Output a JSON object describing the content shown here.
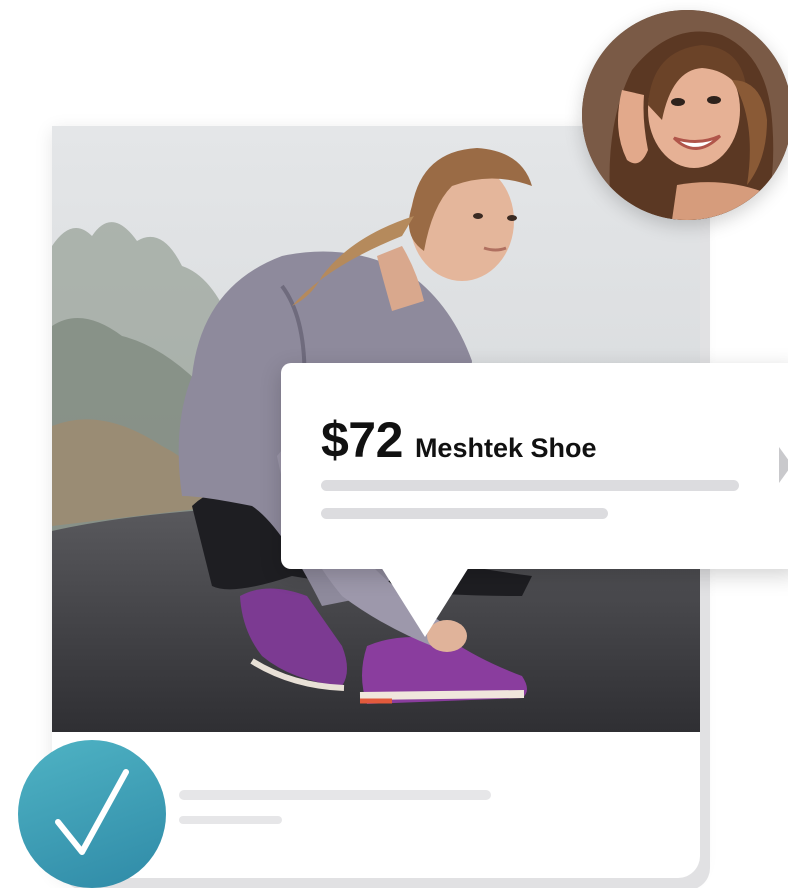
{
  "product": {
    "price": "$72",
    "name": "Meshtek Shoe"
  },
  "icons": {
    "check": "checkmark-icon",
    "next": "chevron-right-icon"
  },
  "colors": {
    "badge": "#3a9db5",
    "placeholder_line": "#dcdcdf",
    "shoe": "#8a3d9e",
    "jacket": "#8e8a9c",
    "road": "#3d3d40"
  }
}
